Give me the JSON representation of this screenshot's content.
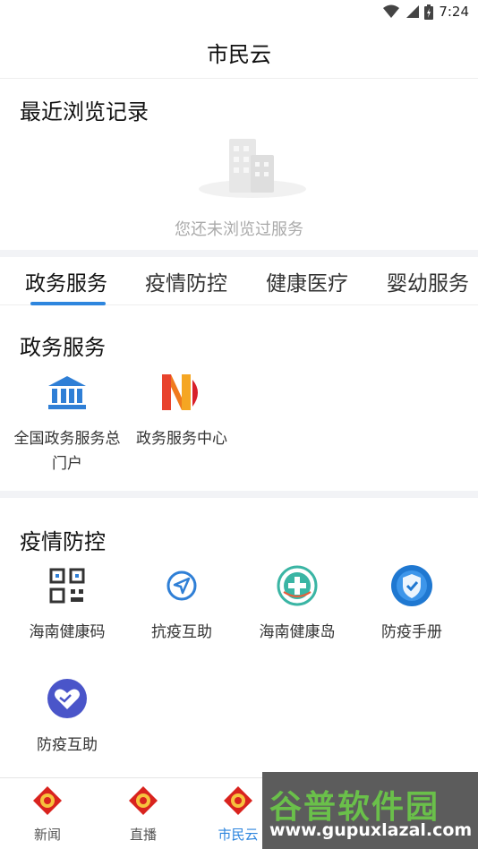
{
  "status_bar": {
    "time": "7:24"
  },
  "header": {
    "title": "市民云"
  },
  "recent": {
    "heading": "最近浏览记录",
    "empty_text": "您还未浏览过服务"
  },
  "tabs": [
    {
      "label": "政务服务"
    },
    {
      "label": "疫情防控"
    },
    {
      "label": "健康医疗"
    },
    {
      "label": "婴幼服务"
    }
  ],
  "gov_section": {
    "title": "政务服务",
    "items": [
      {
        "label": "全国政务服务总门户",
        "icon": "government-building-icon"
      },
      {
        "label": "政务服务中心",
        "icon": "service-center-logo-icon"
      }
    ]
  },
  "epidemic_section": {
    "title": "疫情防控",
    "items": [
      {
        "label": "海南健康码",
        "icon": "qr-code-icon"
      },
      {
        "label": "抗疫互助",
        "icon": "navigation-arrow-icon"
      },
      {
        "label": "海南健康岛",
        "icon": "health-island-icon"
      },
      {
        "label": "防疫手册",
        "icon": "shield-icon"
      },
      {
        "label": "防疫互助",
        "icon": "heart-hands-icon"
      }
    ]
  },
  "tabbar": [
    {
      "label": "新闻"
    },
    {
      "label": "直播"
    },
    {
      "label": "市民云"
    }
  ],
  "watermark": {
    "title": "谷普软件园",
    "url": "www.gupuxlazal.com"
  },
  "colors": {
    "accent": "#2e86de",
    "divider": "#f2f3f6",
    "tab_icon_red": "#d9231e"
  }
}
